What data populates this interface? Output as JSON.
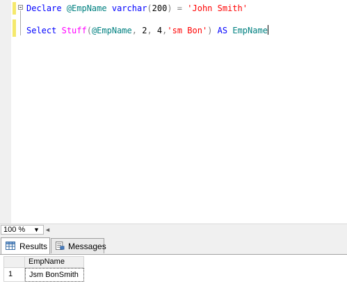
{
  "editor": {
    "line1": {
      "declare": "Declare",
      "var": "@EmpName",
      "type": "varchar",
      "open": "(",
      "size": "200",
      "close": ")",
      "eq": " = ",
      "value": "'John Smith'"
    },
    "line2": {
      "select": "Select",
      "func": "Stuff",
      "open": "(",
      "var": "@EmpName",
      "c1": ",",
      "n1": "2",
      "c2": ",",
      "n2": "4",
      "c3": ",",
      "str": "'sm Bon'",
      "close": ")",
      "as": "AS",
      "alias": "EmpName"
    }
  },
  "zoom": {
    "value": "100 %",
    "arrow": "▼",
    "scroll_left": "◄"
  },
  "tabs": [
    {
      "label": "Results",
      "icon": "grid-icon"
    },
    {
      "label": "Messages",
      "icon": "messages-icon"
    }
  ],
  "grid": {
    "columns": [
      "EmpName"
    ],
    "rows": [
      {
        "num": "1",
        "cells": [
          "Jsm BonSmith"
        ]
      }
    ]
  },
  "colors": {
    "keyword": "#0000ff",
    "function": "#ff00ff",
    "identifier": "#008080",
    "string": "#ff0000",
    "operator": "#808080",
    "change_bar": "#f5e96c"
  }
}
